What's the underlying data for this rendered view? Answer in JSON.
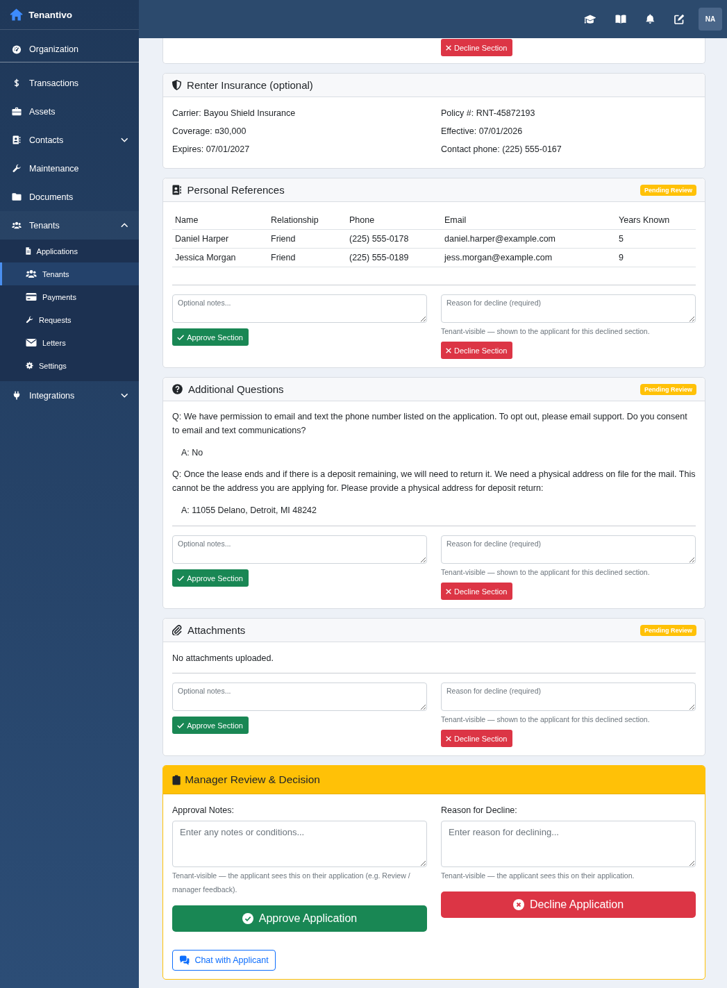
{
  "sidebar": {
    "brand": "Tenantivo",
    "sections": [
      {
        "items": [
          {
            "kind": "link",
            "label": "Organization",
            "selected": false
          }
        ]
      },
      {
        "items": [
          {
            "kind": "link",
            "label": "Transactions",
            "selected": false
          },
          {
            "kind": "link",
            "label": "Assets",
            "selected": false
          },
          {
            "kind": "group",
            "label": "Contacts",
            "selected": false,
            "expanded": false
          },
          {
            "kind": "link",
            "label": "Maintenance",
            "selected": false
          },
          {
            "kind": "link",
            "label": "Documents",
            "selected": false
          },
          {
            "kind": "group",
            "label": "Tenants",
            "selected": false,
            "expanded": true,
            "children": [
              {
                "label": "Applications",
                "selected": false
              },
              {
                "label": "Tenants",
                "selected": true
              },
              {
                "label": "Payments",
                "selected": false
              },
              {
                "label": "Requests",
                "selected": false
              },
              {
                "label": "Letters",
                "selected": false
              },
              {
                "label": "Settings",
                "selected": false
              }
            ]
          },
          {
            "kind": "group",
            "label": "Integrations",
            "selected": false,
            "expanded": false
          }
        ]
      }
    ]
  },
  "topbar": {
    "avatar": "NA"
  },
  "partial_section": {
    "decline_button": "Decline Section"
  },
  "sections": [
    {
      "kind": "details",
      "title": "Renter Insurance (optional)",
      "columns": [
        [
          "Carrier: Bayou Shield Insurance",
          "Coverage: ¤30,000",
          "Expires: 07/01/2027"
        ],
        [
          "Policy #: RNT-45872193",
          "Effective: 07/01/2026",
          "Contact phone: (225) 555-0167"
        ]
      ]
    },
    {
      "kind": "table",
      "title": "Personal References",
      "badge": "Pending Review",
      "columns": [
        "Name",
        "Relationship",
        "Phone",
        "Email",
        "Years Known"
      ],
      "rows": [
        [
          "Daniel Harper",
          "Friend",
          "(225) 555-0178",
          "daniel.harper@example.com",
          "5"
        ],
        [
          "Jessica Morgan",
          "Friend",
          "(225) 555-0189",
          "jess.morgan@example.com",
          "9"
        ]
      ],
      "review": {
        "notes_placeholder": "Optional notes...",
        "approve_button": "Approve Section",
        "decline_placeholder": "Reason for decline (required)",
        "decline_hint": "Tenant-visible — shown to the applicant for this declined section.",
        "decline_button": "Decline Section"
      }
    },
    {
      "kind": "questions",
      "title": "Additional Questions",
      "badge": "Pending Review",
      "items": [
        {
          "question": "Q: We have permission to email and text the phone number listed on the application. To opt out, please email support. Do you consent to email and text communications?",
          "answer": "A: No"
        },
        {
          "question": "Q: Once the lease ends and if there is a deposit remaining, we will need to return it. We need a physical address on file for the mail. This cannot be the address you are applying for. Please provide a physical address for deposit return:",
          "answer": "A: 11055 Delano, Detroit, MI 48242"
        }
      ],
      "review": {
        "notes_placeholder": "Optional notes...",
        "approve_button": "Approve Section",
        "decline_placeholder": "Reason for decline (required)",
        "decline_hint": "Tenant-visible — shown to the applicant for this declined section.",
        "decline_button": "Decline Section"
      }
    },
    {
      "kind": "files",
      "title": "Attachments",
      "badge": "Pending Review",
      "message": "No attachments uploaded.",
      "review": {
        "notes_placeholder": "Optional notes...",
        "approve_button": "Approve Section",
        "decline_placeholder": "Reason for decline (required)",
        "decline_hint": "Tenant-visible — shown to the applicant for this declined section.",
        "decline_button": "Decline Section"
      }
    }
  ],
  "decision": {
    "title": "Manager Review & Decision",
    "approval": {
      "label": "Approval Notes:",
      "placeholder": "Enter any notes or conditions...",
      "hint": "Tenant-visible — the applicant sees this on their application (e.g. Review / manager feedback).",
      "button": "Approve Application"
    },
    "decline": {
      "label": "Reason for Decline:",
      "placeholder": "Enter reason for declining...",
      "hint": "Tenant-visible — the applicant sees this on their application.",
      "button": "Decline Application"
    },
    "chat_button": "Chat with Applicant"
  }
}
